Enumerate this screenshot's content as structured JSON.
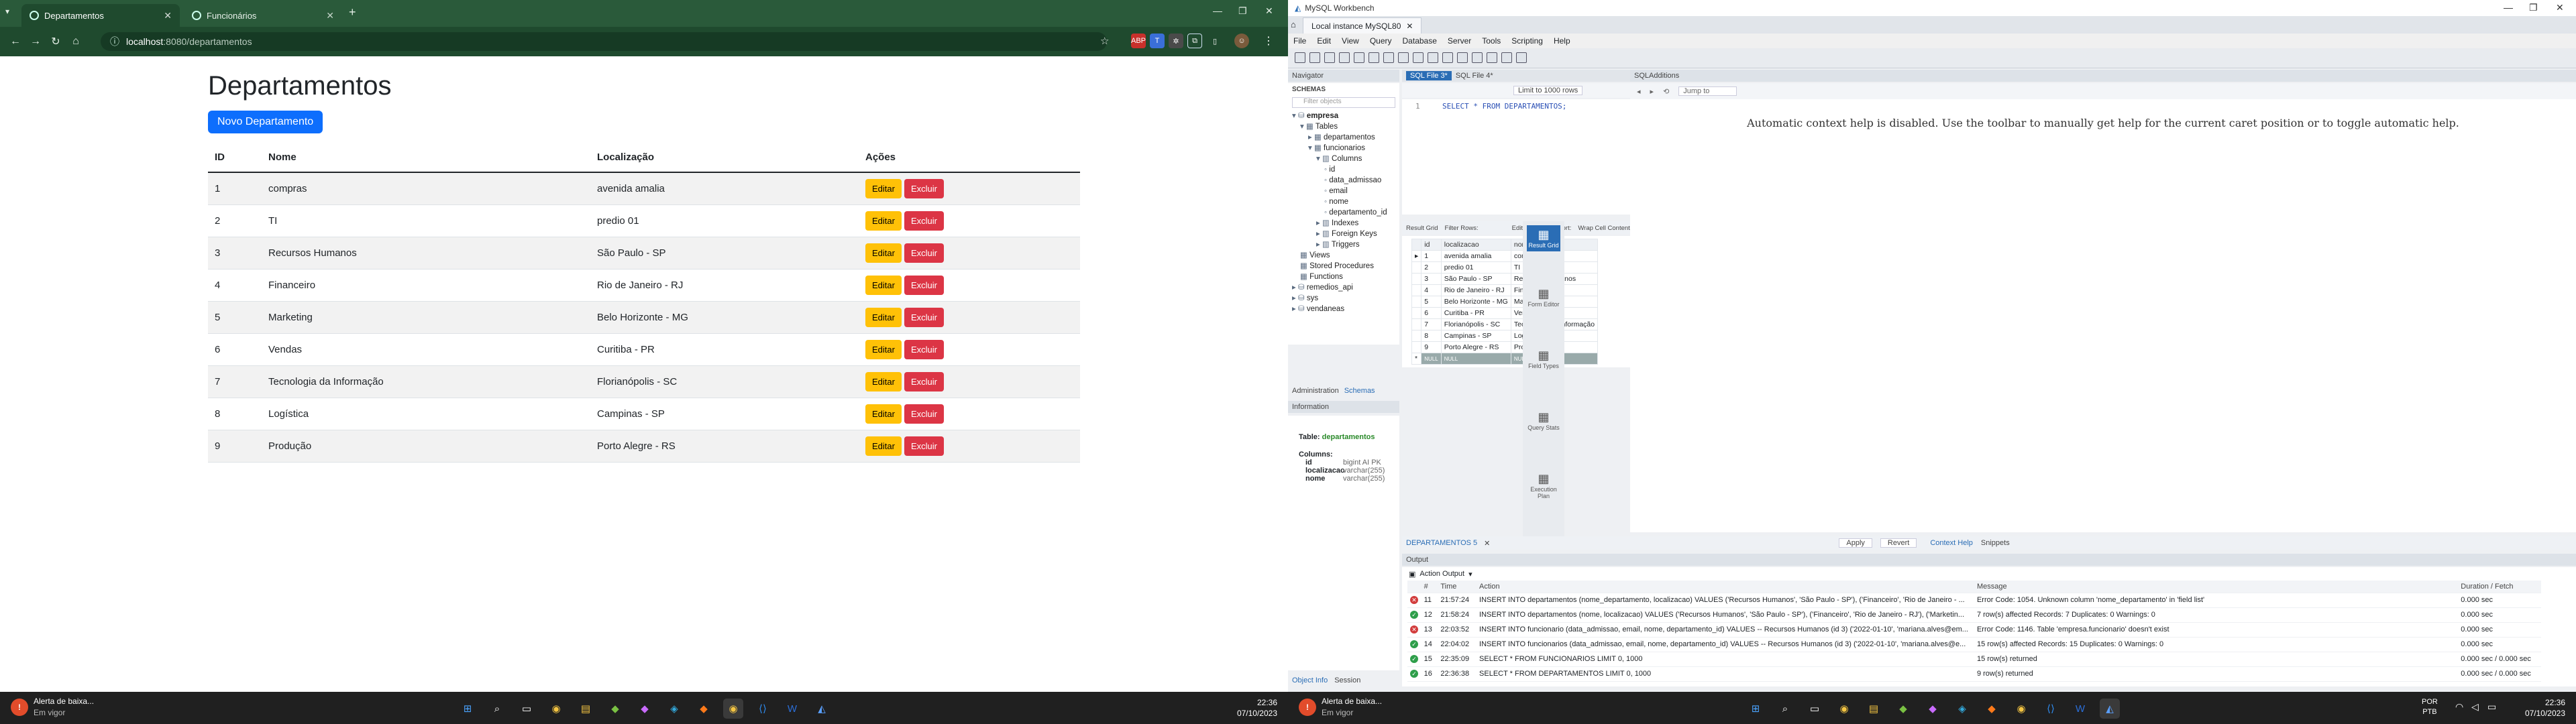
{
  "browser": {
    "tabs": [
      {
        "label": "Departamentos"
      },
      {
        "label": "Funcionários"
      }
    ],
    "url_host": "localhost",
    "url_path": ":8080/departamentos",
    "new_tab": "+"
  },
  "page": {
    "heading": "Departamentos",
    "new_button": "Novo Departamento",
    "columns": [
      "ID",
      "Nome",
      "Localização",
      "Ações"
    ],
    "edit_label": "Editar",
    "delete_label": "Excluir",
    "rows": [
      {
        "id": "1",
        "nome": "compras",
        "loc": "avenida amalia"
      },
      {
        "id": "2",
        "nome": "TI",
        "loc": "predio 01"
      },
      {
        "id": "3",
        "nome": "Recursos Humanos",
        "loc": "São Paulo - SP"
      },
      {
        "id": "4",
        "nome": "Financeiro",
        "loc": "Rio de Janeiro - RJ"
      },
      {
        "id": "5",
        "nome": "Marketing",
        "loc": "Belo Horizonte - MG"
      },
      {
        "id": "6",
        "nome": "Vendas",
        "loc": "Curitiba - PR"
      },
      {
        "id": "7",
        "nome": "Tecnologia da Informação",
        "loc": "Florianópolis - SC"
      },
      {
        "id": "8",
        "nome": "Logística",
        "loc": "Campinas - SP"
      },
      {
        "id": "9",
        "nome": "Produção",
        "loc": "Porto Alegre - RS"
      }
    ]
  },
  "taskbar": {
    "alert_title": "Alerta de baixa...",
    "alert_sub": "Em vigor",
    "time": "22:36",
    "date": "07/10/2023",
    "lang": "POR",
    "lang2": "PTB"
  },
  "workbench": {
    "title": "MySQL Workbench",
    "conn_tab": "Local instance MySQL80",
    "menu": [
      "File",
      "Edit",
      "View",
      "Query",
      "Database",
      "Server",
      "Tools",
      "Scripting",
      "Help"
    ],
    "navigator": "Navigator",
    "schemas_label": "SCHEMAS",
    "filter_placeholder": "Filter objects",
    "tree": [
      "empresa",
      "Tables",
      "departamentos",
      "funcionarios",
      "Columns",
      "id",
      "data_admissao",
      "email",
      "nome",
      "departamento_id",
      "Indexes",
      "Foreign Keys",
      "Triggers",
      "Views",
      "Stored Procedures",
      "Functions",
      "remedios_api",
      "sys",
      "vendaneas"
    ],
    "nav_tabs": [
      "Administration",
      "Schemas"
    ],
    "info_label": "Information",
    "info_table_label": "Table:",
    "info_table": "departamentos",
    "info_columns_label": "Columns:",
    "info_columns": [
      {
        "name": "id",
        "type": "bigint AI PK"
      },
      {
        "name": "localizacao",
        "type": "varchar(255)"
      },
      {
        "name": "nome",
        "type": "varchar(255)"
      }
    ],
    "bottom_tabs": [
      "Object Info",
      "Session"
    ],
    "sql_tabs": [
      "SQL File 3*",
      "SQL File 4*"
    ],
    "limit": "Limit to 1000 rows",
    "line_no": "1",
    "query": "SELECT * FROM DEPARTAMENTOS;",
    "result_grid": "Result Grid",
    "filter_rows": "Filter Rows:",
    "edit": "Edit:",
    "export": "Export/Import:",
    "wrap": "Wrap Cell Content:",
    "grid_cols": [
      "id",
      "localizacao",
      "nome"
    ],
    "grid_rows": [
      [
        "1",
        "avenida amalia",
        "compras"
      ],
      [
        "2",
        "predio 01",
        "TI"
      ],
      [
        "3",
        "São Paulo - SP",
        "Recursos Humanos"
      ],
      [
        "4",
        "Rio de Janeiro - RJ",
        "Financeiro"
      ],
      [
        "5",
        "Belo Horizonte - MG",
        "Marketing"
      ],
      [
        "6",
        "Curitiba - PR",
        "Vendas"
      ],
      [
        "7",
        "Florianópolis - SC",
        "Tecnologia da Informação"
      ],
      [
        "8",
        "Campinas - SP",
        "Logística"
      ],
      [
        "9",
        "Porto Alegre - RS",
        "Produção"
      ],
      [
        "NULL",
        "NULL",
        "NULL"
      ]
    ],
    "side_buttons": [
      "Result Grid",
      "Form Editor",
      "Field Types",
      "Query Stats",
      "Execution Plan"
    ],
    "result_tab": "DEPARTAMENTOS 5",
    "apply": "Apply",
    "revert": "Revert",
    "sql_additions": "SQLAdditions",
    "jump_to": "Jump to",
    "context_help": "Automatic context help is disabled. Use the toolbar to manually get help for the current caret position or to toggle automatic help.",
    "help_tabs": [
      "Context Help",
      "Snippets"
    ],
    "output_label": "Output",
    "action_output": "Action Output",
    "out_cols": [
      "#",
      "Time",
      "Action",
      "Message",
      "Duration / Fetch"
    ],
    "out_rows": [
      {
        "status": "error",
        "n": "11",
        "time": "21:57:24",
        "action": "INSERT INTO departamentos (nome_departamento, localizacao) VALUES ('Recursos Humanos', 'São Paulo - SP'), ('Financeiro', 'Rio de Janeiro - ...",
        "msg": "Error Code: 1054. Unknown column 'nome_departamento' in 'field list'",
        "dur": "0.000 sec"
      },
      {
        "status": "ok",
        "n": "12",
        "time": "21:58:24",
        "action": "INSERT INTO departamentos (nome, localizacao) VALUES ('Recursos Humanos', 'São Paulo - SP'), ('Financeiro', 'Rio de Janeiro - RJ'), ('Marketin...",
        "msg": "7 row(s) affected Records: 7  Duplicates: 0  Warnings: 0",
        "dur": "0.000 sec"
      },
      {
        "status": "error",
        "n": "13",
        "time": "22:03:52",
        "action": "INSERT INTO funcionario (data_admissao, email, nome, departamento_id) VALUES -- Recursos Humanos (id 3) ('2022-01-10', 'mariana.alves@em...",
        "msg": "Error Code: 1146. Table 'empresa.funcionario' doesn't exist",
        "dur": "0.000 sec"
      },
      {
        "status": "ok",
        "n": "14",
        "time": "22:04:02",
        "action": "INSERT INTO funcionarios (data_admissao, email, nome, departamento_id) VALUES -- Recursos Humanos (id 3) ('2022-01-10', 'mariana.alves@e...",
        "msg": "15 row(s) affected Records: 15  Duplicates: 0  Warnings: 0",
        "dur": "0.000 sec"
      },
      {
        "status": "ok",
        "n": "15",
        "time": "22:35:09",
        "action": "SELECT * FROM FUNCIONARIOS LIMIT 0, 1000",
        "msg": "15 row(s) returned",
        "dur": "0.000 sec / 0.000 sec"
      },
      {
        "status": "ok",
        "n": "16",
        "time": "22:36:38",
        "action": "SELECT * FROM DEPARTAMENTOS LIMIT 0, 1000",
        "msg": "9 row(s) returned",
        "dur": "0.000 sec / 0.000 sec"
      }
    ]
  },
  "colors": {
    "chrome": "#1f4a2e",
    "primary": "#0d6efd",
    "warning": "#ffc107",
    "danger": "#dc3545",
    "ok": "#2e9e4a",
    "error": "#d23c3c"
  }
}
